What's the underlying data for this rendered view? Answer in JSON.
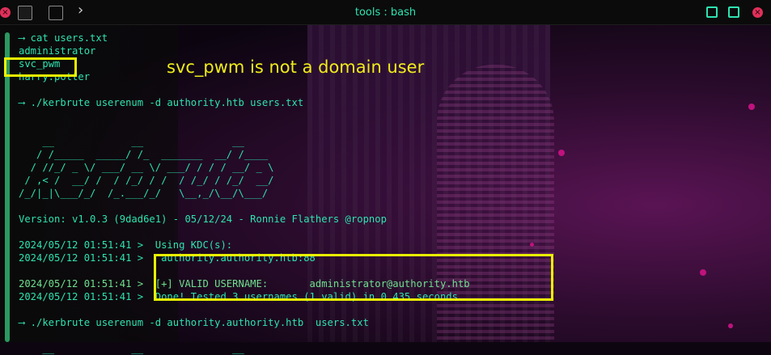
{
  "window": {
    "title": "tools : bash",
    "close_glyph": "×"
  },
  "annotation": {
    "text": "svc_pwm is not a domain user",
    "color": "#e9f200"
  },
  "terminal": {
    "lines": [
      {
        "text": "⟶ cat users.txt",
        "style": "cyan"
      },
      {
        "text": "administrator",
        "style": "cyan"
      },
      {
        "text": "svc_pwm",
        "style": "cyan"
      },
      {
        "text": "harry.potter",
        "style": "cyan"
      },
      {
        "text": "",
        "style": "cyan"
      },
      {
        "text": "⟶ ./kerbrute userenum -d authority.htb users.txt",
        "style": "cyan"
      },
      {
        "text": "",
        "style": "cyan"
      },
      {
        "text": "",
        "style": "cyan"
      },
      {
        "text": "    __             __               __",
        "style": "cyan"
      },
      {
        "text": "   / /_____  _____/ /_  _______  __/ /____",
        "style": "cyan"
      },
      {
        "text": "  / //_/ _ \\/ ___/ __ \\/ ___/ / / / __/ _ \\",
        "style": "cyan"
      },
      {
        "text": " / ,< /  __/ /  / /_/ / /  / /_/ / /_/  __/",
        "style": "cyan"
      },
      {
        "text": "/_/|_|\\___/_/  /_.___/_/   \\__,_/\\__/\\___/",
        "style": "cyan"
      },
      {
        "text": "",
        "style": "cyan"
      },
      {
        "text": "Version: v1.0.3 (9dad6e1) - 05/12/24 - Ronnie Flathers @ropnop",
        "style": "cyan"
      },
      {
        "text": "",
        "style": "cyan"
      },
      {
        "text": "2024/05/12 01:51:41 >  Using KDC(s):",
        "style": "cyan"
      },
      {
        "text": "2024/05/12 01:51:41 >   authority.authority.htb:88",
        "style": "cyan"
      },
      {
        "text": "",
        "style": "cyan"
      },
      {
        "text": "2024/05/12 01:51:41 >  [+] VALID USERNAME:       administrator@authority.htb",
        "style": "green"
      },
      {
        "text": "2024/05/12 01:51:41 >  Done! Tested 3 usernames (1 valid) in 0.435 seconds",
        "style": "cyan"
      },
      {
        "text": "",
        "style": "cyan"
      },
      {
        "text": "⟶ ./kerbrute userenum -d authority.authority.htb  users.txt",
        "style": "cyan"
      },
      {
        "text": "",
        "style": "cyan"
      },
      {
        "text": "    __             __               __",
        "style": "cyan"
      }
    ]
  }
}
